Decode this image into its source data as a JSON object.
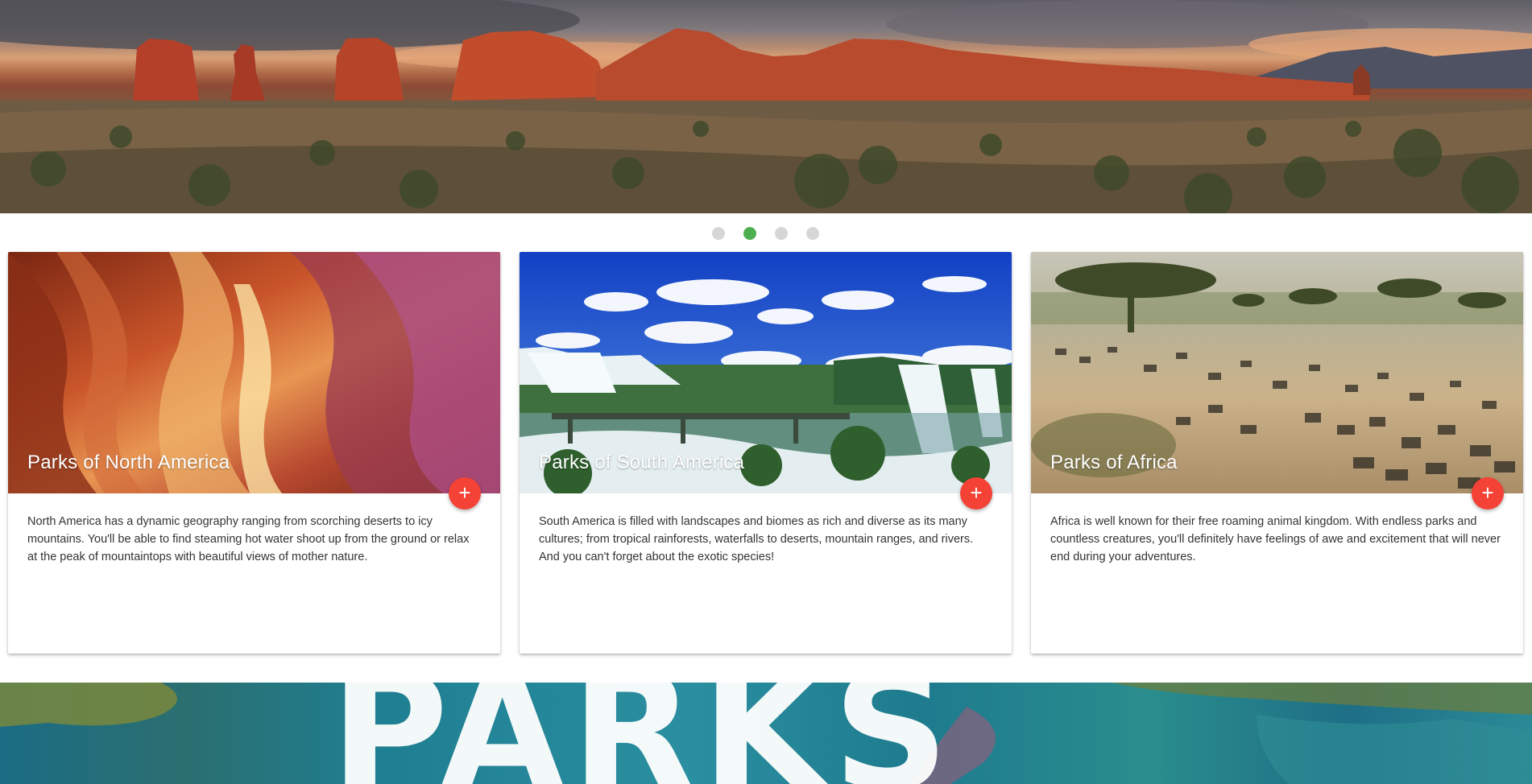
{
  "hero": {
    "slides": [
      {
        "label": "Slide 1"
      },
      {
        "label": "Slide 2"
      },
      {
        "label": "Slide 3"
      },
      {
        "label": "Slide 4"
      }
    ],
    "active_index": 1,
    "active_color": "#4caf50",
    "inactive_color": "#d6d6d6"
  },
  "cards": [
    {
      "title": "Parks of North America",
      "fab_icon": "+",
      "description": "North America has a dynamic geography ranging from scorching deserts to icy mountains. You'll be able to find steaming hot water shoot up from the ground or relax at the peak of mountaintops with beautiful views of mother nature."
    },
    {
      "title": "Parks of South America",
      "fab_icon": "+",
      "description": "South America is filled with landscapes and biomes as rich and diverse as its many cultures; from tropical rainforests, waterfalls to deserts, mountain ranges, and rivers. And you can't forget about the exotic species!"
    },
    {
      "title": "Parks of Africa",
      "fab_icon": "+",
      "description": "Africa is well known for their free roaming animal kingdom. With endless parks and countless creatures, you'll definitely have feelings of awe and excitement that will never end during your adventures."
    }
  ],
  "fab_color": "#f44336",
  "banner": {
    "word": "PARKS"
  }
}
